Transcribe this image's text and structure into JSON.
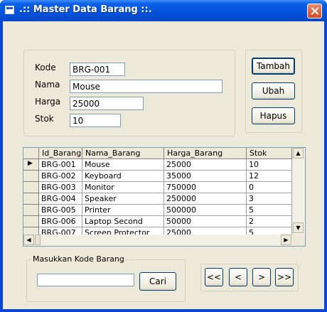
{
  "window": {
    "title": ".:: Master Data Barang ::."
  },
  "form": {
    "kode_label": "Kode",
    "kode_value": "BRG-001",
    "nama_label": "Nama",
    "nama_value": "Mouse",
    "harga_label": "Harga",
    "harga_value": "25000",
    "stok_label": "Stok",
    "stok_value": "10"
  },
  "actions": {
    "tambah": "Tambah",
    "ubah": "Ubah",
    "hapus": "Hapus"
  },
  "grid": {
    "columns": [
      "Id_Barang",
      "Nama_Barang",
      "Harga_Barang",
      "Stok"
    ],
    "rows": [
      [
        "BRG-001",
        "Mouse",
        "25000",
        "10"
      ],
      [
        "BRG-002",
        "Keyboard",
        "35000",
        "12"
      ],
      [
        "BRG-003",
        "Monitor",
        "750000",
        "0"
      ],
      [
        "BRG-004",
        "Speaker",
        "250000",
        "3"
      ],
      [
        "BRG-005",
        "Printer",
        "500000",
        "5"
      ],
      [
        "BRG-006",
        "Laptop Second",
        "50000",
        "2"
      ],
      [
        "BRG-007",
        "Screen Protector",
        "25000",
        "5"
      ]
    ],
    "selected_row_indicator": "▶"
  },
  "search": {
    "group_label": "Masukkan Kode Barang",
    "input_value": "",
    "cari": "Cari"
  },
  "navigation": {
    "first": "<<",
    "prev": "<",
    "next": ">",
    "last": ">>"
  },
  "colors": {
    "titlebar": "#0553dc",
    "face": "#ece9d8",
    "close": "#d24a24"
  }
}
